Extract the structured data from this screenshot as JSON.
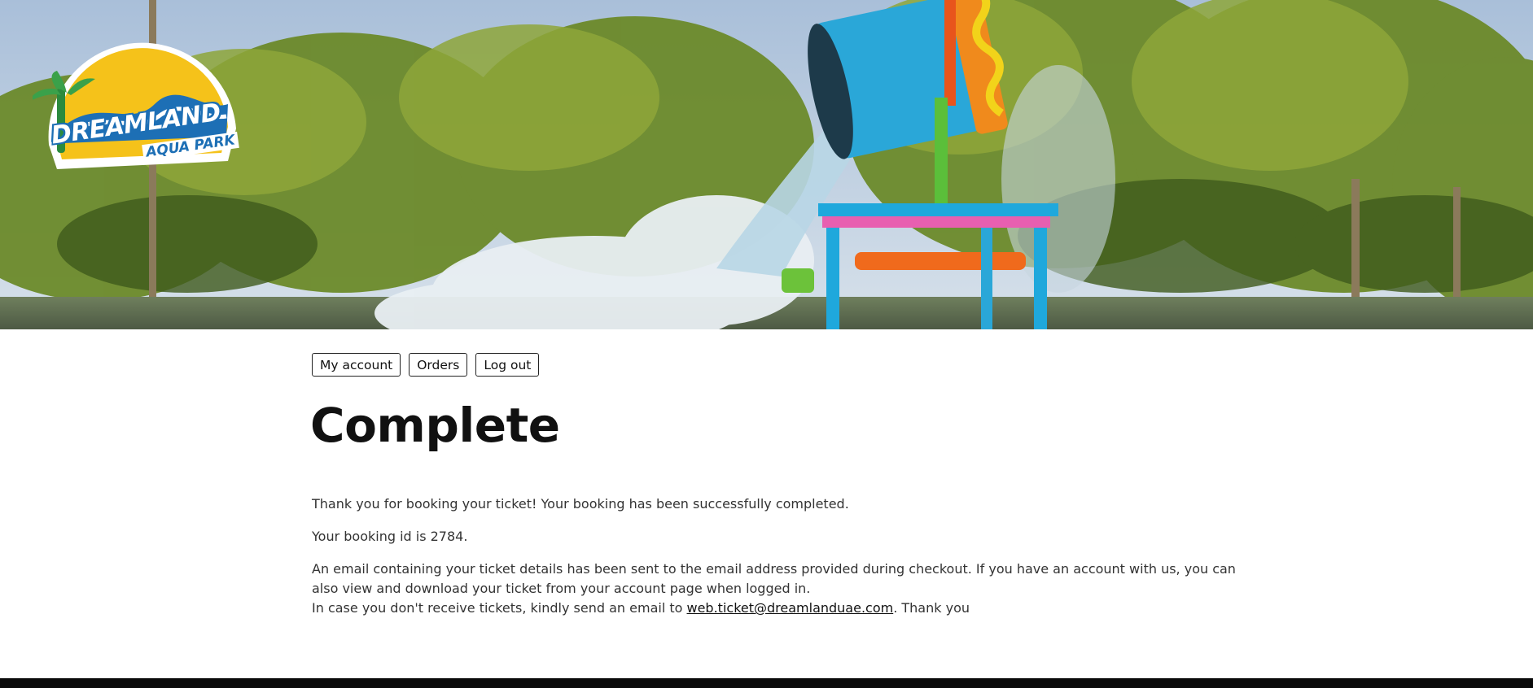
{
  "logo": {
    "line1": "DREAMLAND",
    "line2": "AQUA PARK"
  },
  "nav": {
    "my_account": "My account",
    "orders": "Orders",
    "log_out": "Log out"
  },
  "page": {
    "title": "Complete"
  },
  "message": {
    "p1": "Thank you for booking your ticket! Your booking has been successfully completed.",
    "p2": "Your booking id is 2784.",
    "p3": "An email containing your ticket details has been sent to the email address provided during checkout. If you have an account with us, you can also view and download your ticket from your account page when logged in.",
    "p4_before": "In case you don't receive tickets, kindly send an email to ",
    "email": "web.ticket@dreamlanduae.com",
    "p4_after": ". Thank you"
  },
  "colors": {
    "sky": "#b9cbe0",
    "palm": "#5f7d22",
    "water": "#dde8ef",
    "slide_blue": "#2aa7d8",
    "logo_yellow": "#f5c21a",
    "logo_blue": "#1d6fb5",
    "footer": "#0a0a0a"
  }
}
